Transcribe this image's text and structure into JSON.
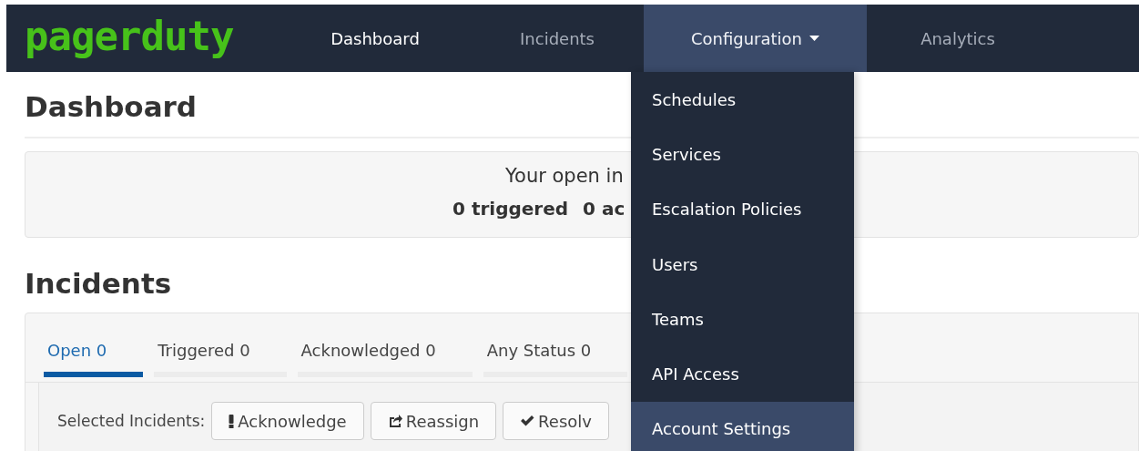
{
  "navbar": {
    "logo": "pagerduty",
    "items": [
      {
        "label": "Dashboard",
        "selected": true,
        "kind": "link"
      },
      {
        "label": "Incidents",
        "selected": false,
        "kind": "link"
      },
      {
        "label": "Configuration",
        "selected": false,
        "kind": "dropdown",
        "expanded": true
      },
      {
        "label": "Analytics",
        "selected": false,
        "kind": "link"
      }
    ]
  },
  "dropdown": {
    "items": [
      {
        "label": "Schedules",
        "selected": false
      },
      {
        "label": "Services",
        "selected": false
      },
      {
        "label": "Escalation Policies",
        "selected": false
      },
      {
        "label": "Users",
        "selected": false
      },
      {
        "label": "Teams",
        "selected": false
      },
      {
        "label": "API Access",
        "selected": false
      },
      {
        "label": "Account Settings",
        "selected": true
      }
    ]
  },
  "page_title": "Dashboard",
  "summary": {
    "line_1": "Your open in",
    "counts": [
      "0 triggered",
      "0 ac"
    ]
  },
  "incidents": {
    "title": "Incidents",
    "tabs": [
      {
        "label": "Open 0",
        "selected": true
      },
      {
        "label": "Triggered 0",
        "selected": false
      },
      {
        "label": "Acknowledged 0",
        "selected": false
      },
      {
        "label": "Any Status 0",
        "selected": false
      }
    ],
    "toolbar_label": "Selected Incidents:",
    "buttons": [
      {
        "label": "Acknowledge",
        "kind": "acknowledge"
      },
      {
        "label": "Reassign",
        "kind": "reassign"
      },
      {
        "label": "Resolv",
        "kind": "resolve"
      }
    ]
  }
}
